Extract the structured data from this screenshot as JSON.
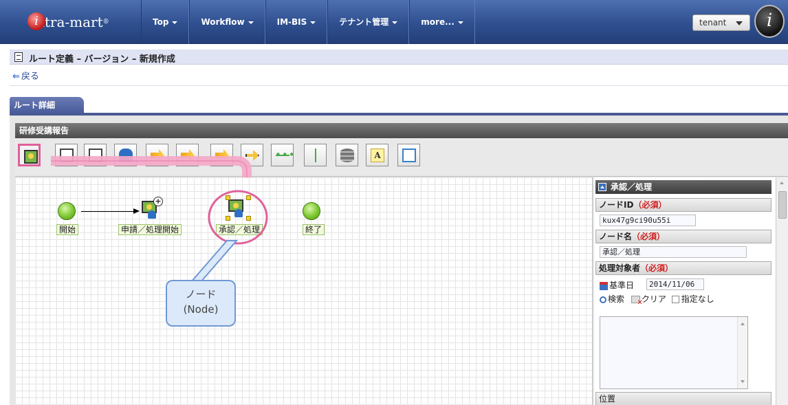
{
  "topbar": {
    "logo_text": "ntra-mart",
    "logo_reg": "®",
    "logo_mark": "i",
    "nav": [
      {
        "label": "Top"
      },
      {
        "label": "Workflow"
      },
      {
        "label": "IM-BIS"
      },
      {
        "label": "テナント管理"
      },
      {
        "label": "more..."
      }
    ],
    "tenant_label": "tenant",
    "avatar_glyph": "i"
  },
  "page": {
    "title": "ルート定義 – バージョン – 新規作成",
    "back_label": "戻る",
    "tab_label": "ルート詳細"
  },
  "editor": {
    "panel_title": "研修受講報告",
    "toolbar": [
      {
        "icon": "approval-node-icon",
        "selected": true
      },
      {
        "icon": "start-node-icon"
      },
      {
        "icon": "screen-node-icon"
      },
      {
        "icon": "user-node-icon"
      },
      {
        "icon": "branch-node-icon"
      },
      {
        "icon": "merge-node-icon"
      },
      {
        "icon": "split-node-icon"
      },
      {
        "icon": "dynamic-branch-icon"
      },
      {
        "icon": "horizontal-connector-icon"
      },
      {
        "icon": "vertical-connector-icon"
      },
      {
        "icon": "database-icon"
      },
      {
        "icon": "text-annotation-icon",
        "glyph": "A"
      },
      {
        "icon": "frame-icon"
      }
    ],
    "nodes": {
      "start_label": "開始",
      "apply_label": "申請／処理開始",
      "approve_label": "承認／処理",
      "end_label": "終了",
      "plus_glyph": "+"
    },
    "callout": {
      "line1": "ノード",
      "line2": "(Node)"
    }
  },
  "properties": {
    "section_title": "承認／処理",
    "node_id_label": "ノードID",
    "required_label": "（必須）",
    "node_id_value": "kux47g9ci90u55i",
    "node_name_label": "ノード名",
    "node_name_value": "承認／処理",
    "target_label": "処理対象者",
    "base_date_label": "基準日",
    "base_date_value": "2014/11/06",
    "search_label": "検索",
    "clear_label": "クリア",
    "unspecified_label": "指定なし",
    "position_label": "位置"
  },
  "colors": {
    "nav_bg": "#2f4f8f",
    "highlight_pink": "#e0609a",
    "callout_blue": "#dce9fa",
    "node_green": "#7cc630",
    "required_red": "#d02020"
  }
}
